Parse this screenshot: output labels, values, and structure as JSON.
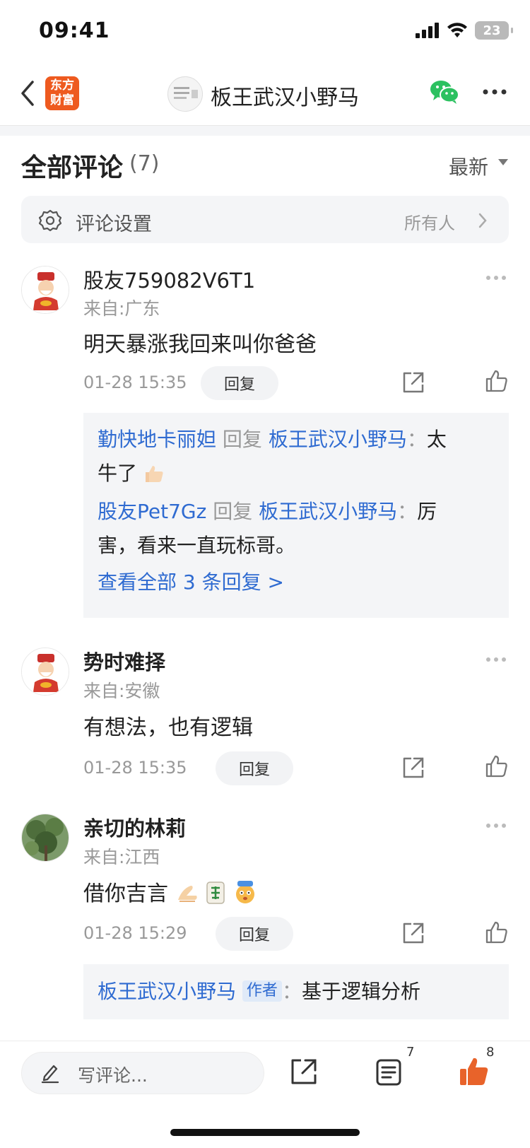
{
  "status_bar": {
    "time": "09:41",
    "battery": "23"
  },
  "nav": {
    "logo_line1": "东方",
    "logo_line2": "财富",
    "title": "板王武汉小野马"
  },
  "section": {
    "title": "全部评论",
    "count": "(7)",
    "sort": "最新"
  },
  "settings": {
    "label": "评论设置",
    "value": "所有人"
  },
  "comments": [
    {
      "user": "股友759082V6T1",
      "from": "来自:广东",
      "text": "明天暴涨我回来叫你爸爸",
      "time": "01-28 15:35",
      "reply_label": "回复",
      "replies": [
        {
          "user": "勤快地卡丽妲",
          "verb": "回复",
          "target": "板王武汉小野马",
          "sep": "：",
          "text_a": "太",
          "text_b": "牛了"
        },
        {
          "user": "股友Pet7Gz",
          "verb": "回复",
          "target": "板王武汉小野马",
          "sep": "：",
          "text_a": "厉",
          "text_b": "害，看来一直玩标哥。"
        }
      ],
      "view_all": "查看全部 3 条回复 >"
    },
    {
      "user": "势时难择",
      "from": "来自:安徽",
      "text": "有想法，也有逻辑",
      "time": "01-28 15:35",
      "reply_label": "回复"
    },
    {
      "user": "亲切的林莉",
      "from": "来自:江西",
      "text": "借你吉言",
      "time": "01-28 15:29",
      "reply_label": "回复",
      "author_reply": {
        "user": "板王武汉小野马",
        "tag": "作者",
        "sep": "：",
        "text": "基于逻辑分析"
      }
    }
  ],
  "bottom_bar": {
    "placeholder": "写评论...",
    "comment_count": "7",
    "like_count": "8"
  },
  "colors": {
    "brand": "#ee5a1f",
    "link": "#2f6bd1",
    "like": "#e8632a",
    "wechat": "#2cc160"
  }
}
